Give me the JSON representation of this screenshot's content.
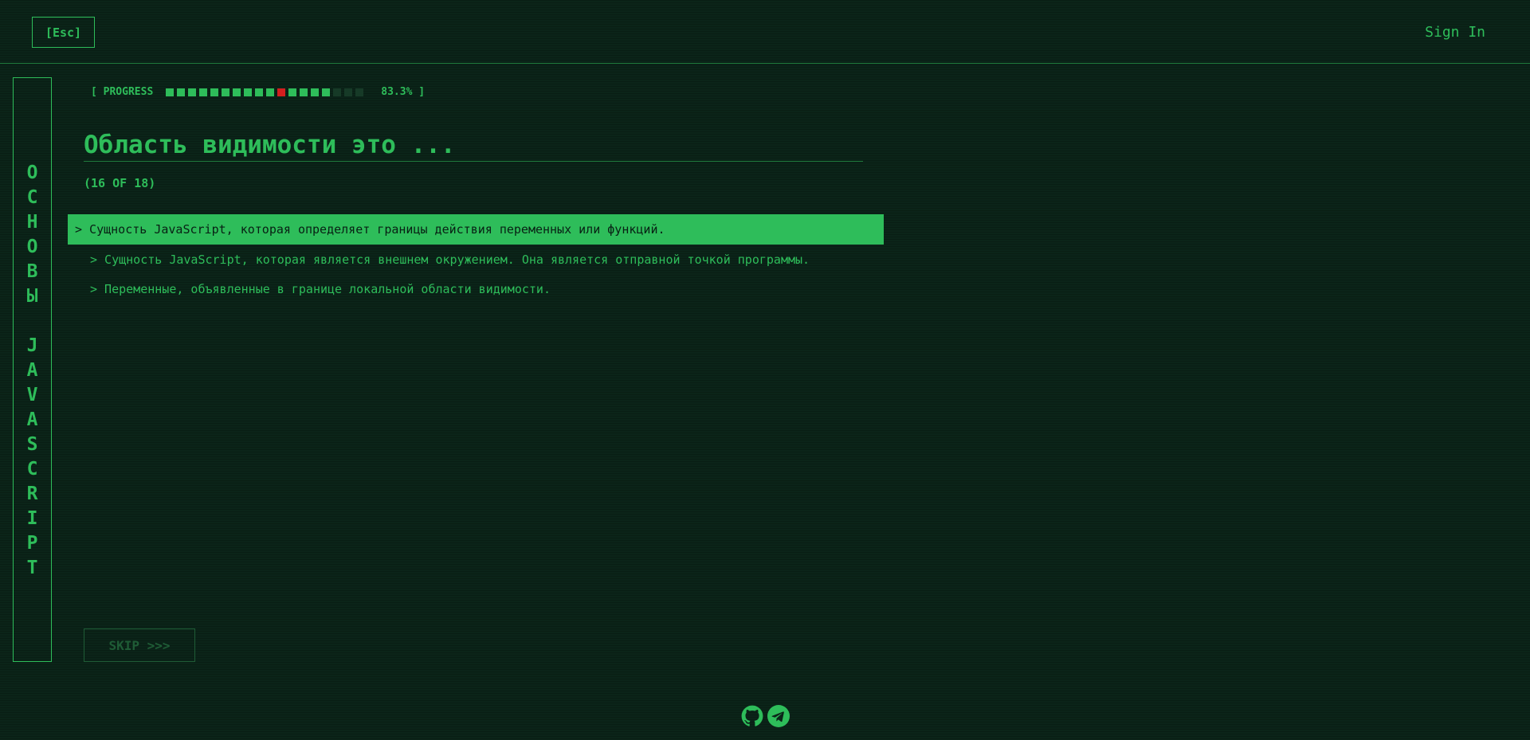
{
  "header": {
    "esc_label": "[Esc]",
    "signin_label": "Sign In"
  },
  "sidebar": {
    "title_letters": [
      "О",
      "С",
      "Н",
      "О",
      "В",
      "Ы",
      " ",
      "J",
      "A",
      "V",
      "A",
      "S",
      "C",
      "R",
      "I",
      "P",
      "T"
    ]
  },
  "progress": {
    "label": "[ PROGRESS",
    "percent_text": "83.3% ]",
    "total_blocks": 18,
    "completed_blocks": 15,
    "current_block": 10
  },
  "quiz": {
    "question": "Область видимости это ...",
    "counter": "(16 OF 18)",
    "answers": [
      {
        "text": "> Сущность JavaScript, которая определяет границы действия переменных или функций.",
        "selected": true
      },
      {
        "text": "> Сущность JavaScript, которая является внешнем окружением. Она является отправной точкой программы.",
        "selected": false
      },
      {
        "text": "> Переменные, объявленные в границе локальной области видимости.",
        "selected": false
      }
    ]
  },
  "controls": {
    "skip_label": "SKIP >>>"
  },
  "footer": {
    "icons": [
      "github-icon",
      "telegram-icon"
    ]
  },
  "colors": {
    "accent": "#2ebd5a",
    "background": "#0b2419",
    "current_progress": "#d31f1f"
  }
}
